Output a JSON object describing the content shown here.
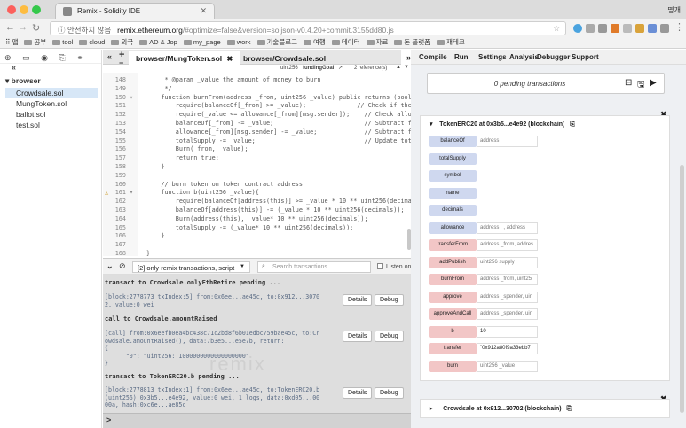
{
  "browser": {
    "tab_title": "Remix - Solidity IDE",
    "profile": "명개",
    "security_label": "안전하지 않음",
    "url_host": "remix.ethereum.org",
    "url_rest": "/#optimize=false&version=soljson-v0.4.20+commit.3155dd80.js",
    "bookmarks": [
      "앱",
      "공부",
      "tool",
      "cloud",
      "외국",
      "AD & Jop",
      "my_page",
      "work",
      "기술블로그",
      "여행",
      "데이터",
      "자료",
      "돈 플랫폼",
      "재테크"
    ]
  },
  "colors": {
    "call_button": "#cfd8ef",
    "transact_button": "#f2c6c6",
    "tx_text": "#5a6b84"
  },
  "file_explorer": {
    "root": "browser",
    "files": [
      "Crowdsale.sol",
      "MungToken.sol",
      "ballot.sol",
      "test.sol"
    ],
    "selected": "Crowdsale.sol"
  },
  "editor": {
    "tabs": [
      "browser/MungToken.sol",
      "browser/Crowdsale.sol"
    ],
    "active_tab": "browser/MungToken.sol",
    "info_type": "uint256",
    "info_name": "fundingGoal",
    "info_refs": "2 reference(s)",
    "lines": [
      {
        "n": "148",
        "code": "     * @param _value the amount of money to burn"
      },
      {
        "n": "149",
        "code": "     */"
      },
      {
        "n": "150",
        "code": "    function burnFrom(address _from, uint256 _value) public returns (bool su"
      },
      {
        "n": "151",
        "code": "        require(balanceOf[_from] >= _value);              // Check if the"
      },
      {
        "n": "152",
        "code": "        require(_value <= allowance[_from][msg.sender]);    // Check allowa"
      },
      {
        "n": "153",
        "code": "        balanceOf[_from] -= _value;                         // Subtract fro"
      },
      {
        "n": "154",
        "code": "        allowance[_from][msg.sender] -= _value;             // Subtract fro"
      },
      {
        "n": "155",
        "code": "        totalSupply -= _value;                              // Update total"
      },
      {
        "n": "156",
        "code": "        Burn(_from, _value);"
      },
      {
        "n": "157",
        "code": "        return true;"
      },
      {
        "n": "158",
        "code": "    }"
      },
      {
        "n": "159",
        "code": ""
      },
      {
        "n": "160",
        "code": "    // burn token on token contract address"
      },
      {
        "n": "161",
        "code": "    function b(uint256 _value){"
      },
      {
        "n": "162",
        "code": "        require(balanceOf[address(this)] >= _value * 10 ** uint256(decimals)"
      },
      {
        "n": "163",
        "code": "        balanceOf[address(this)] -= (_value * 10 ** uint256(decimals));"
      },
      {
        "n": "164",
        "code": "        Burn(address(this), _value* 10 ** uint256(decimals));"
      },
      {
        "n": "165",
        "code": "        totalSupply -= (_value* 10 ** uint256(decimals));"
      },
      {
        "n": "166",
        "code": "    }"
      },
      {
        "n": "167",
        "code": ""
      },
      {
        "n": "168",
        "code": "}"
      },
      {
        "n": "169",
        "code": ""
      }
    ]
  },
  "terminal": {
    "filter": "[2] only remix transactions, script",
    "search_placeholder": "Search transactions",
    "listen": "Listen on n",
    "details": "Details",
    "debug": "Debug",
    "h1": "transact to Crowdsale.onlyEthRetire pending ...",
    "t1": "[block:2778773 txIndex:5] from:0x6ee...ae45c, to:0x912...3070\n2, value:0 wei",
    "h2": "call to Crowdsale.amountRaised",
    "t2": "[call] from:0x6eefb0ea4bc438c71c2bd8f6b01edbc759bae45c, to:Cr\nowdsale.amountRaised(), data:7b3e5...e5e7b, return:\n{\n      \"0\": \"uint256: 1000000000000000000\"\n}",
    "h3": "transact to TokenERC20.b pending ...",
    "t3": "[block:2778813 txIndex:1] from:0x6ee...ae45c, to:TokenERC20.b\n(uint256) 0x3b5...e4e92, value:0 wei, 1 logs, data:0xd05...00\n00a, hash:0xc6e...ae85c",
    "prompt": ">",
    "watermark": "remix"
  },
  "right_tabs": [
    "Compile",
    "Run",
    "Settings",
    "Analysis",
    "Debugger",
    "Support"
  ],
  "run": {
    "pending": "0 pending transactions",
    "contract_a": "TokenERC20 at 0x3b5...e4e92 (blockchain)",
    "functions": [
      {
        "label": "balanceOf",
        "kind": "call",
        "input": "address"
      },
      {
        "label": "totalSupply",
        "kind": "call",
        "input": ""
      },
      {
        "label": "symbol",
        "kind": "call",
        "input": ""
      },
      {
        "label": "name",
        "kind": "call",
        "input": ""
      },
      {
        "label": "decimals",
        "kind": "call",
        "input": ""
      },
      {
        "label": "allowance",
        "kind": "call",
        "input": "address _, address"
      },
      {
        "label": "transferFrom",
        "kind": "transact",
        "input": "address _from, addres"
      },
      {
        "label": "addPublish",
        "kind": "transact",
        "input": "uint256 supply"
      },
      {
        "label": "burnFrom",
        "kind": "transact",
        "input": "address _from, uint25"
      },
      {
        "label": "approve",
        "kind": "transact",
        "input": "address _spender, uin"
      },
      {
        "label": "approveAndCall",
        "kind": "transact",
        "input": "address _spender, uin"
      },
      {
        "label": "b",
        "kind": "transact",
        "input": "10",
        "filled": true
      },
      {
        "label": "transfer",
        "kind": "transact",
        "input": "\"0x912a80f9a33ebb7",
        "filled": true
      },
      {
        "label": "burn",
        "kind": "transact",
        "input": "uint256 _value"
      }
    ],
    "contract_b": "Crowdsale at 0x912...30702 (blockchain)"
  }
}
